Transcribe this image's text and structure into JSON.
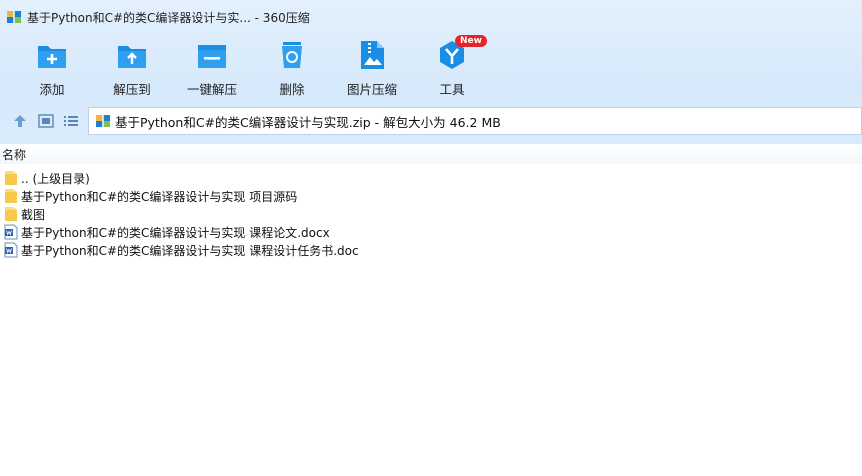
{
  "window": {
    "title": "基于Python和C#的类C编译器设计与实... - 360压缩"
  },
  "toolbar": {
    "items": [
      {
        "label": "添加",
        "icon": "add-icon"
      },
      {
        "label": "解压到",
        "icon": "extract-to-icon"
      },
      {
        "label": "一键解压",
        "icon": "one-click-extract-icon"
      },
      {
        "label": "删除",
        "icon": "delete-icon"
      },
      {
        "label": "图片压缩",
        "icon": "image-compress-icon"
      },
      {
        "label": "工具",
        "icon": "tools-icon",
        "badge": "New"
      }
    ]
  },
  "address": {
    "text": "基于Python和C#的类C编译器设计与实现.zip - 解包大小为 46.2 MB"
  },
  "columns": {
    "name": "名称"
  },
  "files": [
    {
      "name": ".. (上级目录)",
      "type": "folder"
    },
    {
      "name": "基于Python和C#的类C编译器设计与实现 项目源码",
      "type": "folder"
    },
    {
      "name": "截图",
      "type": "folder"
    },
    {
      "name": "基于Python和C#的类C编译器设计与实现 课程论文.docx",
      "type": "word"
    },
    {
      "name": "基于Python和C#的类C编译器设计与实现 课程设计任务书.doc",
      "type": "word"
    }
  ],
  "colors": {
    "accent": "#1a8ee5",
    "toolbar_bg": "#d6e9fb",
    "folder": "#f6c94a",
    "badge": "#e8242b"
  }
}
